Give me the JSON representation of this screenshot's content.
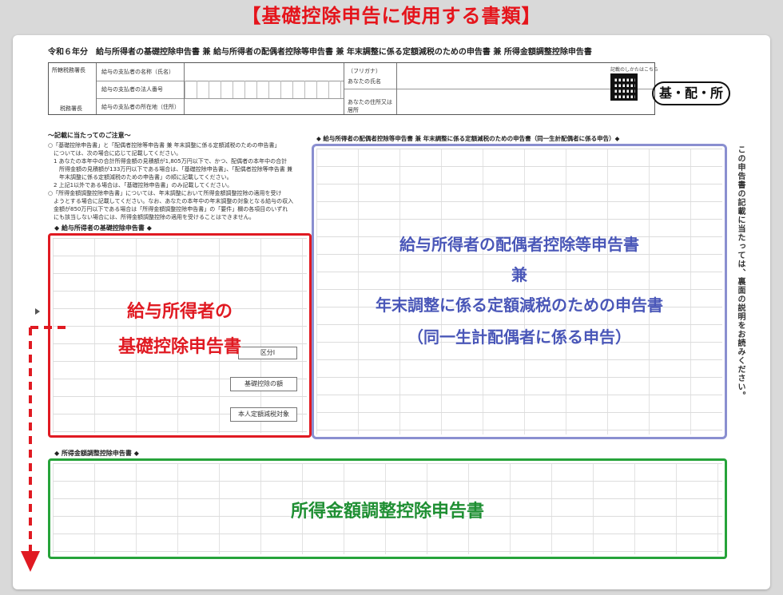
{
  "banner": "【基礎控除申告に使用する書類】",
  "form": {
    "title": "令和６年分　給与所得者の基礎控除申告書 兼 給与所得者の配偶者控除等申告書 兼 年末調整に係る定額減税のための申告書 兼 所得金額調整控除申告書",
    "stamp": "基・配・所",
    "qr_caption": "記載のしかたはこちら"
  },
  "header": {
    "office_label": "所轄税務署長",
    "office_label2": "税務署長",
    "payer_name_label": "給与の支払者の名称（氏名）",
    "payer_number_label": "給与の支払者の法人番号",
    "payer_address_label": "給与の支払者の所在地（住所）",
    "furigana_label": "（フリガナ）",
    "your_name_label": "あなたの氏名",
    "your_address_label": "あなたの住所又は居所"
  },
  "notes": {
    "head": "～記載に当たってのご注意～",
    "lines": [
      "○「基礎控除申告書」と「配偶者控除等申告書 兼 年末調整に係る定額減税のための申告書」",
      "　については、次の場合に応じて記載してください。",
      "　1 あなたの本年中の合計所得金額の見積額が1,805万円以下で、かつ、配偶者の本年中の合計",
      "　　所得金額の見積額が133万円以下である場合は、「基礎控除申告書」、「配偶者控除等申告書 兼",
      "　　年末調整に係る定額減税のための申告書」の順に記載してください。",
      "　2 上記1以外である場合は、「基礎控除申告書」のみ記載してください。",
      "○「所得金額調整控除申告書」については、年末調整において所得金額調整控除の適用を受け",
      "　ようとする場合に記載してください。なお、あなたの本年中の年末調整の対象となる給与の収入",
      "　金額が850万円以下である場合は「所得金額調整控除申告書」の「要件」欄の各項目のいずれ",
      "　にも該当しない場合には、所得金額調整控除の適用を受けることはできません。"
    ]
  },
  "sections": {
    "basic": "◆ 給与所得者の基礎控除申告書 ◆",
    "spouse": "◆ 給与所得者の配偶者控除等申告書 兼 年末調整に係る定額減税のための申告書（同一生計配偶者に係る申告）◆",
    "adjust": "◆ 所得金額調整控除申告書 ◆"
  },
  "overlays": {
    "red_line1": "給与所得者の",
    "red_line2": "基礎控除申告書",
    "blue_line1": "給与所得者の配偶者控除等申告書",
    "blue_line2": "兼",
    "blue_line3": "年末調整に係る定額減税のための申告書",
    "blue_line4": "（同一生計配偶者に係る申告）",
    "green_line": "所得金額調整控除申告書"
  },
  "mini": {
    "kubun": "区分Ⅰ",
    "kiso": "基礎控除の額",
    "teigaku": "本人定額減税対象"
  },
  "side_note": "この申告書の記載に当たっては、裏面の説明をお読みください。",
  "colors": {
    "banner": "#e5141b",
    "red_box": "#e01a22",
    "blue_box": "#8a8fd0",
    "green_box": "#26a33a"
  }
}
